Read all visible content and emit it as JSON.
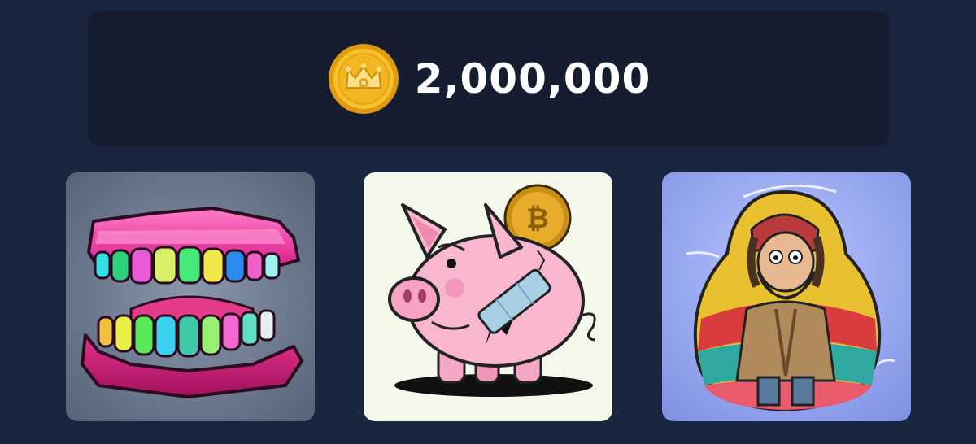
{
  "balance": {
    "amount": "2,000,000",
    "icon": "crown-coin-icon"
  },
  "cards": [
    {
      "icon": "rainbow-teeth-image"
    },
    {
      "icon": "broken-piggy-bank-bitcoin-image"
    },
    {
      "icon": "bearded-man-nesting-doll-image"
    }
  ],
  "colors": {
    "background": "#1a2540",
    "balance_card": "#161d30",
    "coin_gold": "#f2b523",
    "text": "#ffffff"
  }
}
